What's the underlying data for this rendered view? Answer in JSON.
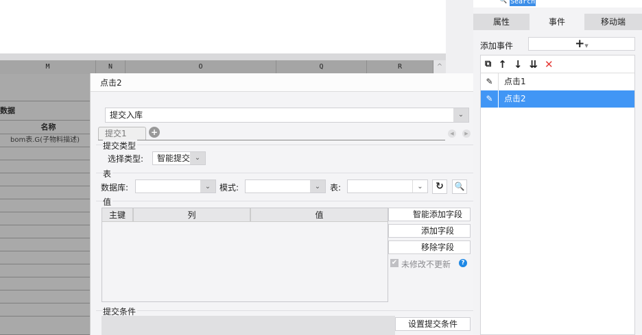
{
  "sheet": {
    "columns": [
      "M",
      "N",
      "O",
      "Q",
      "R"
    ],
    "cells": {
      "data_label": "数据",
      "name_header": "名称",
      "name_value": "bom表.G(子物料描述)"
    }
  },
  "dialog": {
    "title": "点击2",
    "action_select": "提交入库",
    "tabs": [
      "提交1"
    ],
    "submit_type": {
      "section": "提交类型",
      "label": "选择类型:",
      "value": "智能提交"
    },
    "table": {
      "section": "表",
      "db_label": "数据库:",
      "db_value": "",
      "mode_label": "模式:",
      "mode_value": "",
      "table_label": "表:",
      "table_value": ""
    },
    "values": {
      "section": "值",
      "headers": [
        "主键",
        "列",
        "值"
      ],
      "smart_add": "智能添加字段",
      "add": "添加字段",
      "remove": "移除字段",
      "no_update_label": "未修改不更新",
      "no_update_checked": true
    },
    "condition": {
      "section": "提交条件",
      "button": "设置提交条件"
    }
  },
  "right_panel": {
    "search": "Search",
    "tabs": [
      "属性",
      "事件",
      "移动端"
    ],
    "active_tab": "事件",
    "add_event_label": "添加事件",
    "events": [
      {
        "label": "点击1",
        "selected": false
      },
      {
        "label": "点击2",
        "selected": true
      }
    ]
  },
  "colors": {
    "selected": "#4196f5",
    "delete": "#e53935",
    "help": "#1e88e5"
  }
}
